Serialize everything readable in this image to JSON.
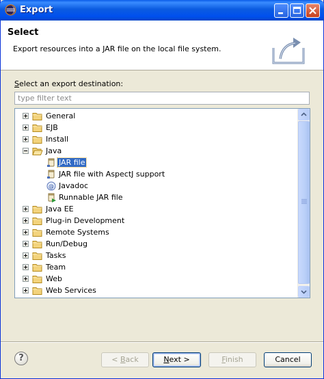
{
  "window": {
    "title": "Export",
    "controls": [
      "minimize",
      "maximize",
      "close"
    ]
  },
  "header": {
    "title": "Select",
    "message": "Export resources into a JAR file on the local file system."
  },
  "destination": {
    "label_prefix": "S",
    "label_rest": "elect an export destination:",
    "filter_placeholder": "type filter text"
  },
  "tree": {
    "items": [
      {
        "label": "General",
        "icon": "folder-icon",
        "expanded": false,
        "level": 0
      },
      {
        "label": "EJB",
        "icon": "folder-icon",
        "expanded": false,
        "level": 0
      },
      {
        "label": "Install",
        "icon": "folder-icon",
        "expanded": false,
        "level": 0
      },
      {
        "label": "Java",
        "icon": "folder-open-icon",
        "expanded": true,
        "level": 0
      },
      {
        "label": "JAR file",
        "icon": "jar-icon",
        "level": 1,
        "selected": true
      },
      {
        "label": "JAR file with AspectJ support",
        "icon": "jar-icon",
        "level": 1
      },
      {
        "label": "Javadoc",
        "icon": "javadoc-icon",
        "level": 1
      },
      {
        "label": "Runnable JAR file",
        "icon": "runnable-jar-icon",
        "level": 1
      },
      {
        "label": "Java EE",
        "icon": "folder-icon",
        "expanded": false,
        "level": 0
      },
      {
        "label": "Plug-in Development",
        "icon": "folder-icon",
        "expanded": false,
        "level": 0
      },
      {
        "label": "Remote Systems",
        "icon": "folder-icon",
        "expanded": false,
        "level": 0
      },
      {
        "label": "Run/Debug",
        "icon": "folder-icon",
        "expanded": false,
        "level": 0
      },
      {
        "label": "Tasks",
        "icon": "folder-icon",
        "expanded": false,
        "level": 0
      },
      {
        "label": "Team",
        "icon": "folder-icon",
        "expanded": false,
        "level": 0
      },
      {
        "label": "Web",
        "icon": "folder-icon",
        "expanded": false,
        "level": 0
      },
      {
        "label": "Web Services",
        "icon": "folder-icon",
        "expanded": false,
        "level": 0
      }
    ]
  },
  "buttons": {
    "back": {
      "pre": "< ",
      "key": "B",
      "post": "ack",
      "enabled": false
    },
    "next": {
      "key": "N",
      "post": "ext >",
      "enabled": true
    },
    "finish": {
      "key": "F",
      "post": "inish",
      "enabled": false
    },
    "cancel": {
      "label": "Cancel",
      "enabled": true
    }
  },
  "help": {
    "glyph": "?"
  },
  "colors": {
    "selection": "#316ac5",
    "titlebar": "#0054e3",
    "dialog_bg": "#ece9d8"
  }
}
